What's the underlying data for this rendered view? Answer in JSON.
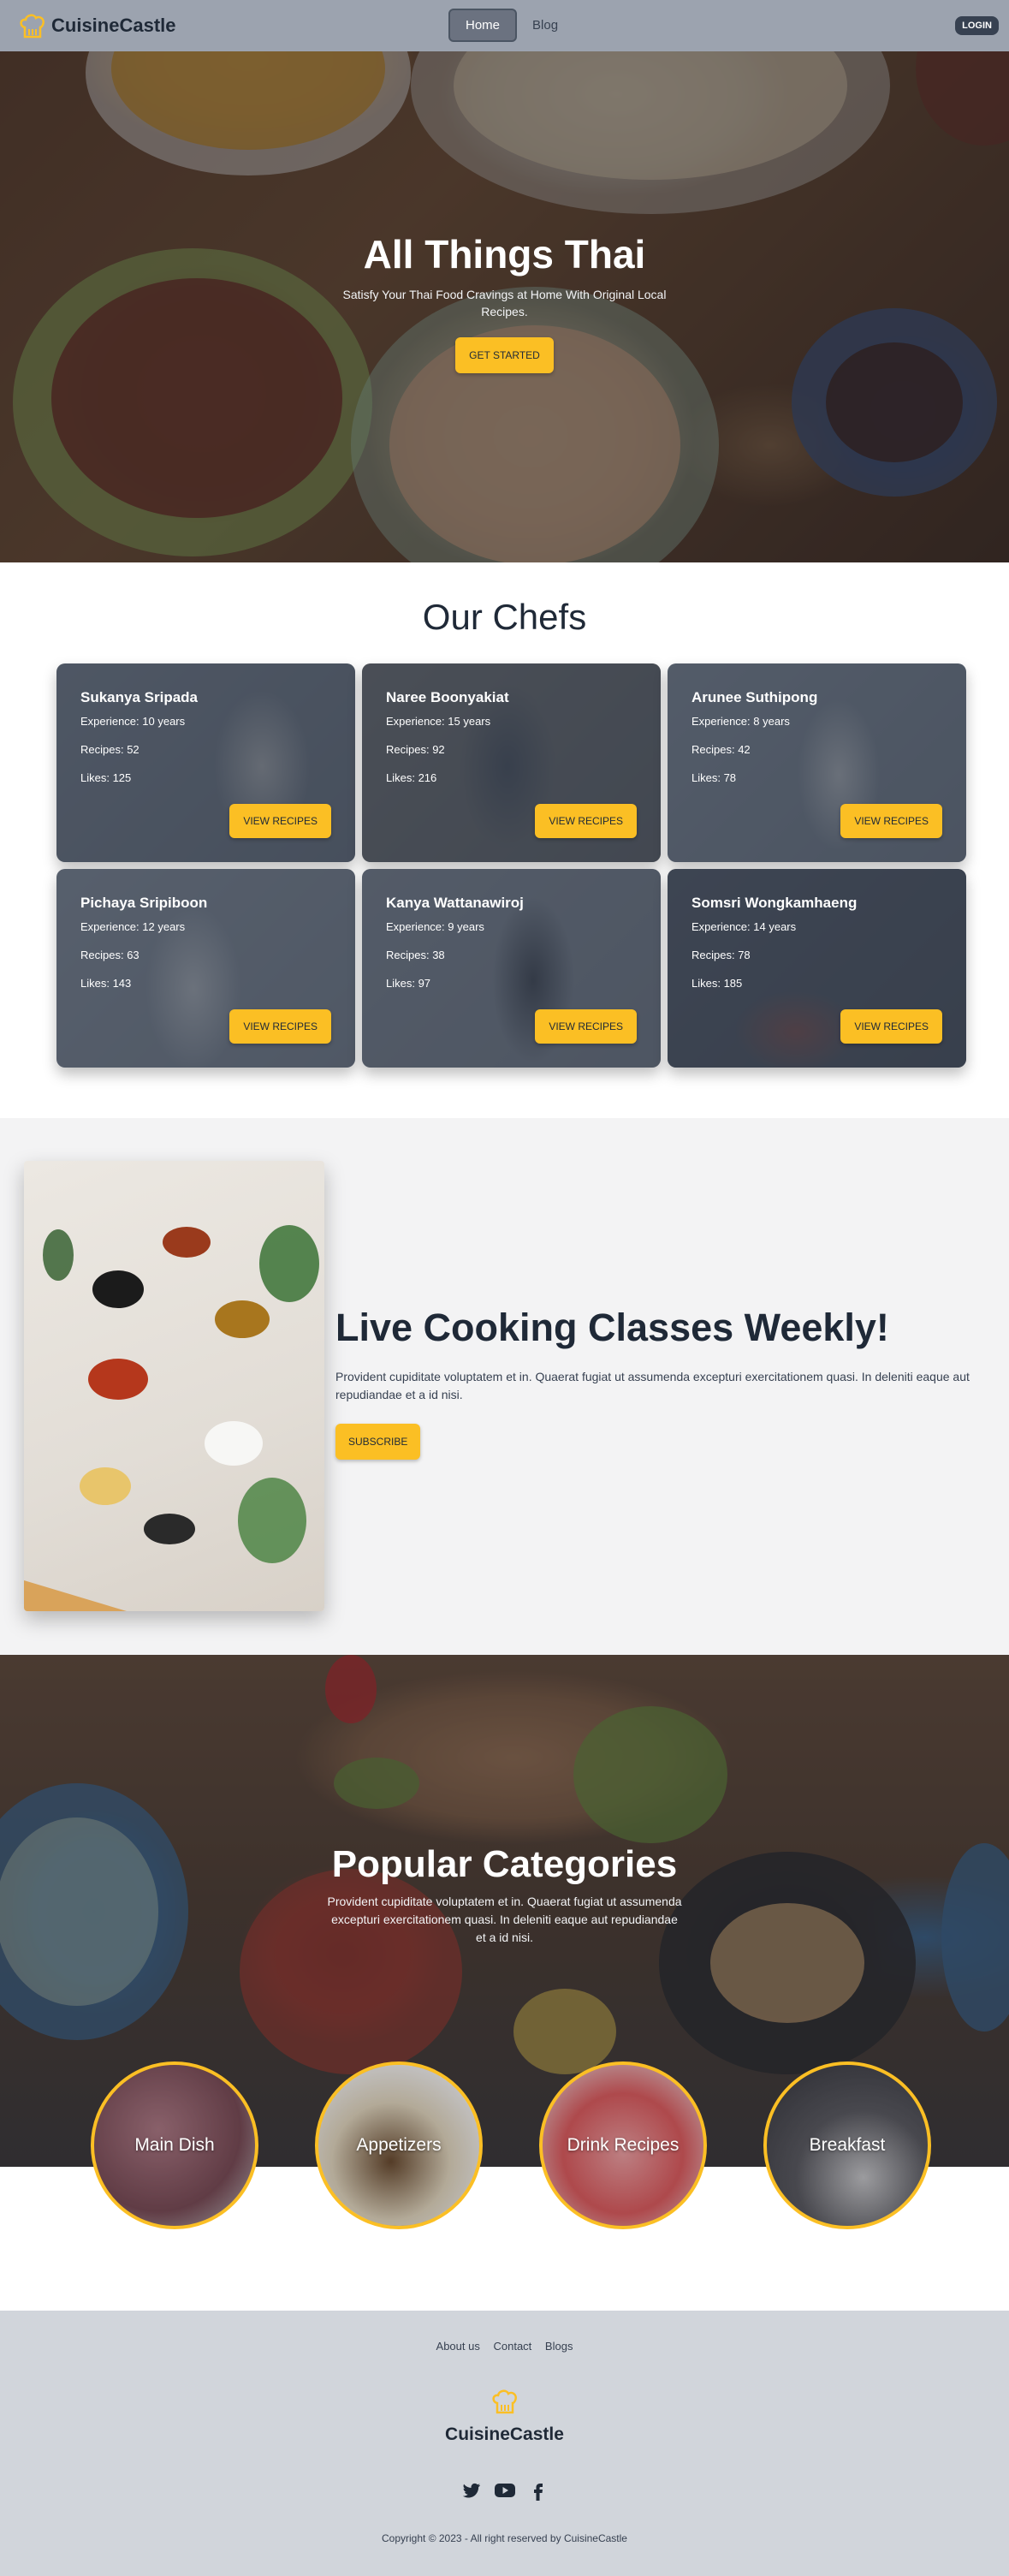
{
  "nav": {
    "brand": "CuisineCastle",
    "links": [
      "Home",
      "Blog"
    ],
    "login": "LOGIN"
  },
  "hero": {
    "title": "All Things Thai",
    "subtitle": "Satisfy Your Thai Food Cravings at Home With Original Local Recipes.",
    "button": "GET STARTED"
  },
  "chefs": {
    "title": "Our Chefs",
    "button_label": "VIEW RECIPES",
    "items": [
      {
        "name": "Sukanya Sripada",
        "experience": "Experience: 10 years",
        "recipes": "Recipes: 52",
        "likes": "Likes: 125"
      },
      {
        "name": "Naree Boonyakiat",
        "experience": "Experience: 15 years",
        "recipes": "Recipes: 92",
        "likes": "Likes: 216"
      },
      {
        "name": "Arunee Suthipong",
        "experience": "Experience: 8 years",
        "recipes": "Recipes: 42",
        "likes": "Likes: 78"
      },
      {
        "name": "Pichaya Sripiboon",
        "experience": "Experience: 12 years",
        "recipes": "Recipes: 63",
        "likes": "Likes: 143"
      },
      {
        "name": "Kanya Wattanawiroj",
        "experience": "Experience: 9 years",
        "recipes": "Recipes: 38",
        "likes": "Likes: 97"
      },
      {
        "name": "Somsri Wongkamhaeng",
        "experience": "Experience: 14 years",
        "recipes": "Recipes: 78",
        "likes": "Likes: 185"
      }
    ]
  },
  "live": {
    "title": "Live Cooking Classes Weekly!",
    "text": "Provident cupiditate voluptatem et in. Quaerat fugiat ut assumenda excepturi exercitationem quasi. In deleniti eaque aut repudiandae et a id nisi.",
    "button": "SUBSCRIBE"
  },
  "categories": {
    "title": "Popular Categories",
    "subtitle": "Provident cupiditate voluptatem et in. Quaerat fugiat ut assumenda excepturi exercitationem quasi. In deleniti eaque aut repudiandae et a id nisi.",
    "items": [
      "Main Dish",
      "Appetizers",
      "Drink Recipes",
      "Breakfast"
    ]
  },
  "footer": {
    "links": [
      "About us",
      "Contact",
      "Blogs"
    ],
    "brand": "CuisineCastle",
    "social": [
      "twitter-icon",
      "youtube-icon",
      "facebook-icon"
    ],
    "copyright": "Copyright © 2023 - All right reserved by CuisineCastle"
  },
  "colors": {
    "accent": "#fbbf24",
    "nav_bg": "#9ca3af",
    "footer_bg": "#d1d5db",
    "text_dark": "#1f2937"
  }
}
